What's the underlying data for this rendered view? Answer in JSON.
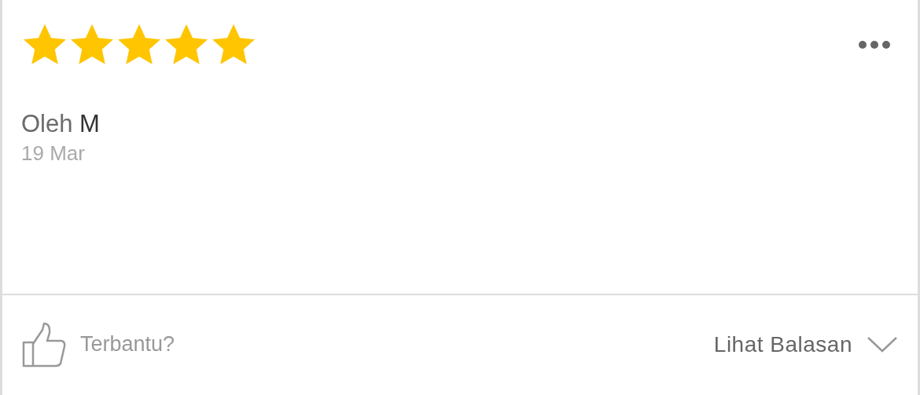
{
  "review": {
    "stars": 5,
    "author": "Oleh **M**",
    "date": "19 Mar"
  },
  "footer": {
    "helpful": "Terbantu?",
    "replies": "Lihat Balasan"
  }
}
